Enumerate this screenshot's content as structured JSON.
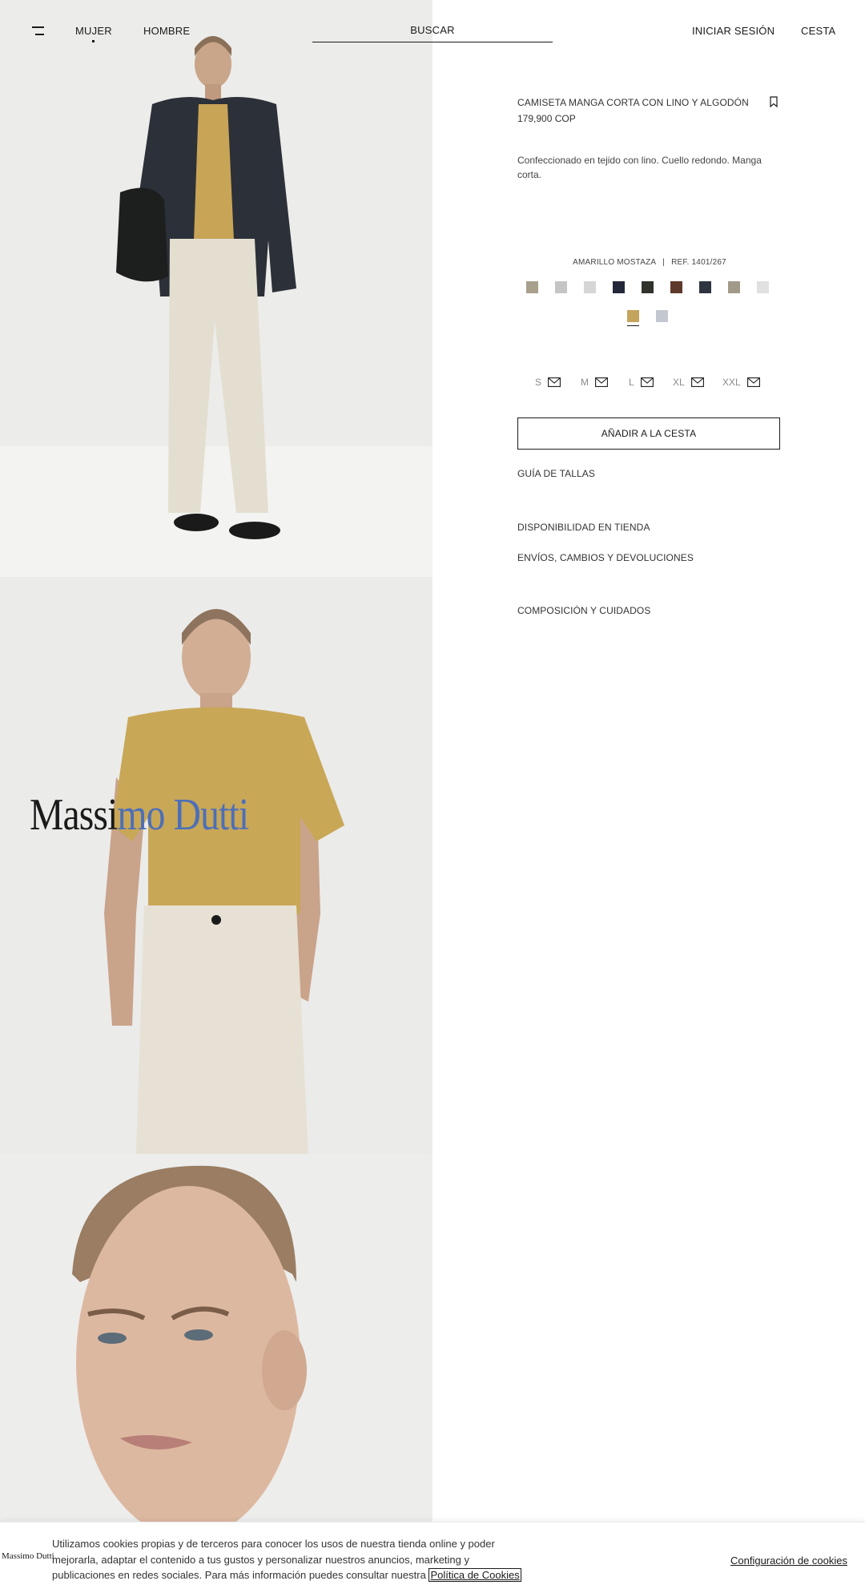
{
  "header": {
    "nav_women": "MUJER",
    "nav_men": "HOMBRE",
    "search_label": "BUSCAR",
    "login": "INICIAR SESIÓN",
    "cart": "CESTA"
  },
  "product": {
    "title": "CAMISETA MANGA CORTA CON LINO Y ALGODÓN",
    "price": "179,900 COP",
    "description": "Confeccionado en tejido con lino. Cuello redondo. Manga corta.",
    "color_name": "AMARILLO MOSTAZA",
    "color_separator": "|",
    "reference": "REF. 1401/267",
    "swatches": [
      {
        "color": "#a8a08c"
      },
      {
        "color": "#c5c5c5"
      },
      {
        "color": "#d6d6d6"
      },
      {
        "color": "#24283a"
      },
      {
        "color": "#2f332c"
      },
      {
        "color": "#5e3a2c"
      },
      {
        "color": "#2e3440"
      },
      {
        "color": "#a29a88"
      },
      {
        "color": "#e0e0e0"
      },
      {
        "color": "#c4a45c",
        "selected": true
      },
      {
        "color": "#c3c8d0"
      }
    ],
    "sizes": [
      {
        "label": "S",
        "icon": "envelope-icon"
      },
      {
        "label": "M",
        "icon": "envelope-icon"
      },
      {
        "label": "L",
        "icon": "envelope-icon"
      },
      {
        "label": "XL",
        "icon": "envelope-icon"
      },
      {
        "label": "XXL",
        "icon": "envelope-icon"
      }
    ],
    "add_to_cart": "AÑADIR A LA CESTA",
    "size_guide": "GUÍA DE TALLAS",
    "store_availability": "DISPONIBILIDAD EN TIENDA",
    "shipping": "ENVÍOS, CAMBIOS Y DEVOLUCIONES",
    "composition": "COMPOSICIÓN Y CUIDADOS"
  },
  "brand": {
    "logo_part1": "Massi",
    "logo_part2": "mo Dutti"
  },
  "cookie": {
    "logo": "Massimo Dutti",
    "text": "Utilizamos cookies propias y de terceros para conocer los usos de nuestra tienda online y poder mejorarla, adaptar el contenido a tus gustos y personalizar nuestros anuncios, marketing y publicaciones en redes sociales. Para más información puedes consultar nuestra",
    "policy_link": "Política de Cookies",
    "settings_link": "Configuración de cookies"
  }
}
